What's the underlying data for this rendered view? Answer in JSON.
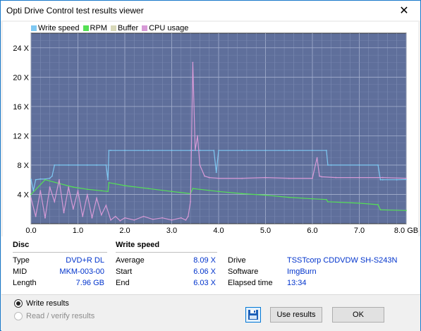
{
  "window": {
    "title": "Opti Drive Control test results viewer",
    "close_glyph": "✕"
  },
  "legend": [
    {
      "label": "Write speed",
      "color": "#7ec8f2"
    },
    {
      "label": "RPM",
      "color": "#55e055"
    },
    {
      "label": "Buffer",
      "color": "#d8d8b8"
    },
    {
      "label": "CPU usage",
      "color": "#d79ad7"
    }
  ],
  "chart_data": {
    "type": "line",
    "xlabel": "",
    "ylabel": "",
    "xlim": [
      0,
      8.0
    ],
    "ylim": [
      0,
      26
    ],
    "x_ticks": [
      "0.0",
      "1.0",
      "2.0",
      "3.0",
      "4.0",
      "5.0",
      "6.0",
      "7.0",
      "8.0 GB"
    ],
    "y_ticks": [
      "4 X",
      "8 X",
      "12 X",
      "16 X",
      "20 X",
      "24 X"
    ],
    "y_tick_values": [
      4,
      8,
      12,
      16,
      20,
      24
    ],
    "background": "#5f6f9b",
    "grid": true,
    "series": [
      {
        "name": "Write speed",
        "color": "#7ec8f2",
        "x": [
          0.0,
          0.05,
          0.1,
          0.2,
          0.3,
          0.4,
          0.45,
          0.5,
          0.6,
          0.8,
          1.0,
          1.2,
          1.4,
          1.6,
          1.64,
          1.66,
          1.7,
          2.0,
          2.5,
          3.0,
          3.4,
          3.45,
          3.6,
          3.9,
          3.95,
          4.0,
          4.5,
          5.0,
          5.5,
          6.0,
          6.3,
          6.33,
          6.4,
          7.0,
          7.4,
          7.45,
          7.5,
          7.8,
          8.0
        ],
        "y": [
          6.06,
          4.5,
          6.0,
          6.1,
          6.1,
          6.2,
          6.5,
          8.0,
          8.0,
          8.0,
          8.0,
          8.0,
          8.0,
          8.0,
          6.0,
          10.0,
          10.0,
          10.0,
          10.0,
          10.0,
          10.0,
          10.0,
          10.0,
          10.0,
          7.0,
          10.0,
          10.0,
          10.0,
          10.0,
          10.0,
          10.0,
          8.0,
          8.0,
          8.0,
          8.0,
          6.0,
          6.0,
          6.0,
          6.03
        ]
      },
      {
        "name": "RPM",
        "color": "#55e055",
        "x": [
          0.0,
          0.3,
          0.6,
          0.9,
          1.2,
          1.5,
          1.64,
          1.66,
          2.0,
          2.5,
          3.0,
          3.4,
          3.45,
          4.0,
          4.5,
          5.0,
          5.5,
          6.0,
          6.3,
          6.33,
          7.0,
          7.4,
          7.45,
          8.0
        ],
        "y": [
          4.0,
          6.0,
          5.5,
          5.0,
          4.7,
          4.5,
          4.4,
          5.6,
          5.2,
          4.8,
          4.4,
          4.1,
          4.8,
          4.4,
          4.1,
          3.9,
          3.6,
          3.4,
          3.3,
          3.0,
          2.8,
          2.6,
          1.9,
          1.8
        ]
      },
      {
        "name": "CPU usage",
        "color": "#d79ad7",
        "x": [
          0.0,
          0.1,
          0.2,
          0.3,
          0.4,
          0.5,
          0.6,
          0.7,
          0.8,
          0.9,
          1.0,
          1.1,
          1.2,
          1.3,
          1.4,
          1.5,
          1.6,
          1.7,
          1.8,
          1.9,
          2.0,
          2.2,
          2.4,
          2.6,
          2.8,
          3.0,
          3.2,
          3.3,
          3.35,
          3.4,
          3.42,
          3.45,
          3.5,
          3.55,
          3.6,
          3.7,
          3.8,
          4.0,
          4.5,
          5.0,
          5.5,
          6.0,
          6.1,
          6.15,
          6.2,
          6.5,
          7.0,
          7.5,
          8.0
        ],
        "y": [
          3.5,
          1.0,
          4.5,
          0.8,
          5.0,
          3.0,
          6.0,
          1.5,
          5.0,
          2.0,
          4.5,
          1.0,
          4.0,
          0.8,
          3.5,
          1.2,
          2.5,
          0.5,
          1.0,
          0.4,
          0.8,
          0.5,
          1.0,
          0.6,
          0.8,
          0.5,
          0.8,
          0.5,
          1.0,
          3.0,
          10.0,
          22.0,
          10.0,
          12.0,
          8.0,
          6.5,
          6.3,
          6.2,
          6.2,
          6.3,
          6.2,
          6.2,
          9.0,
          6.5,
          6.4,
          6.3,
          6.3,
          6.3,
          6.2
        ]
      }
    ]
  },
  "disc": {
    "heading": "Disc",
    "rows": [
      {
        "label": "Type",
        "value": "DVD+R DL"
      },
      {
        "label": "MID",
        "value": "MKM-003-00"
      },
      {
        "label": "Length",
        "value": "7.96 GB"
      }
    ]
  },
  "write_speed": {
    "heading": "Write speed",
    "rows": [
      {
        "label": "Average",
        "value": "8.09 X"
      },
      {
        "label": "Start",
        "value": "6.06 X"
      },
      {
        "label": "End",
        "value": "6.03 X"
      }
    ]
  },
  "drive_info": {
    "rows": [
      {
        "label": "Drive",
        "value": "TSSTcorp  CDDVDW SH-S243N"
      },
      {
        "label": "Software",
        "value": "ImgBurn"
      },
      {
        "label": "Elapsed time",
        "value": "13:34"
      }
    ]
  },
  "bottom": {
    "radio_write": "Write results",
    "radio_read": "Read / verify results",
    "use_results": "Use results",
    "ok": "OK"
  }
}
